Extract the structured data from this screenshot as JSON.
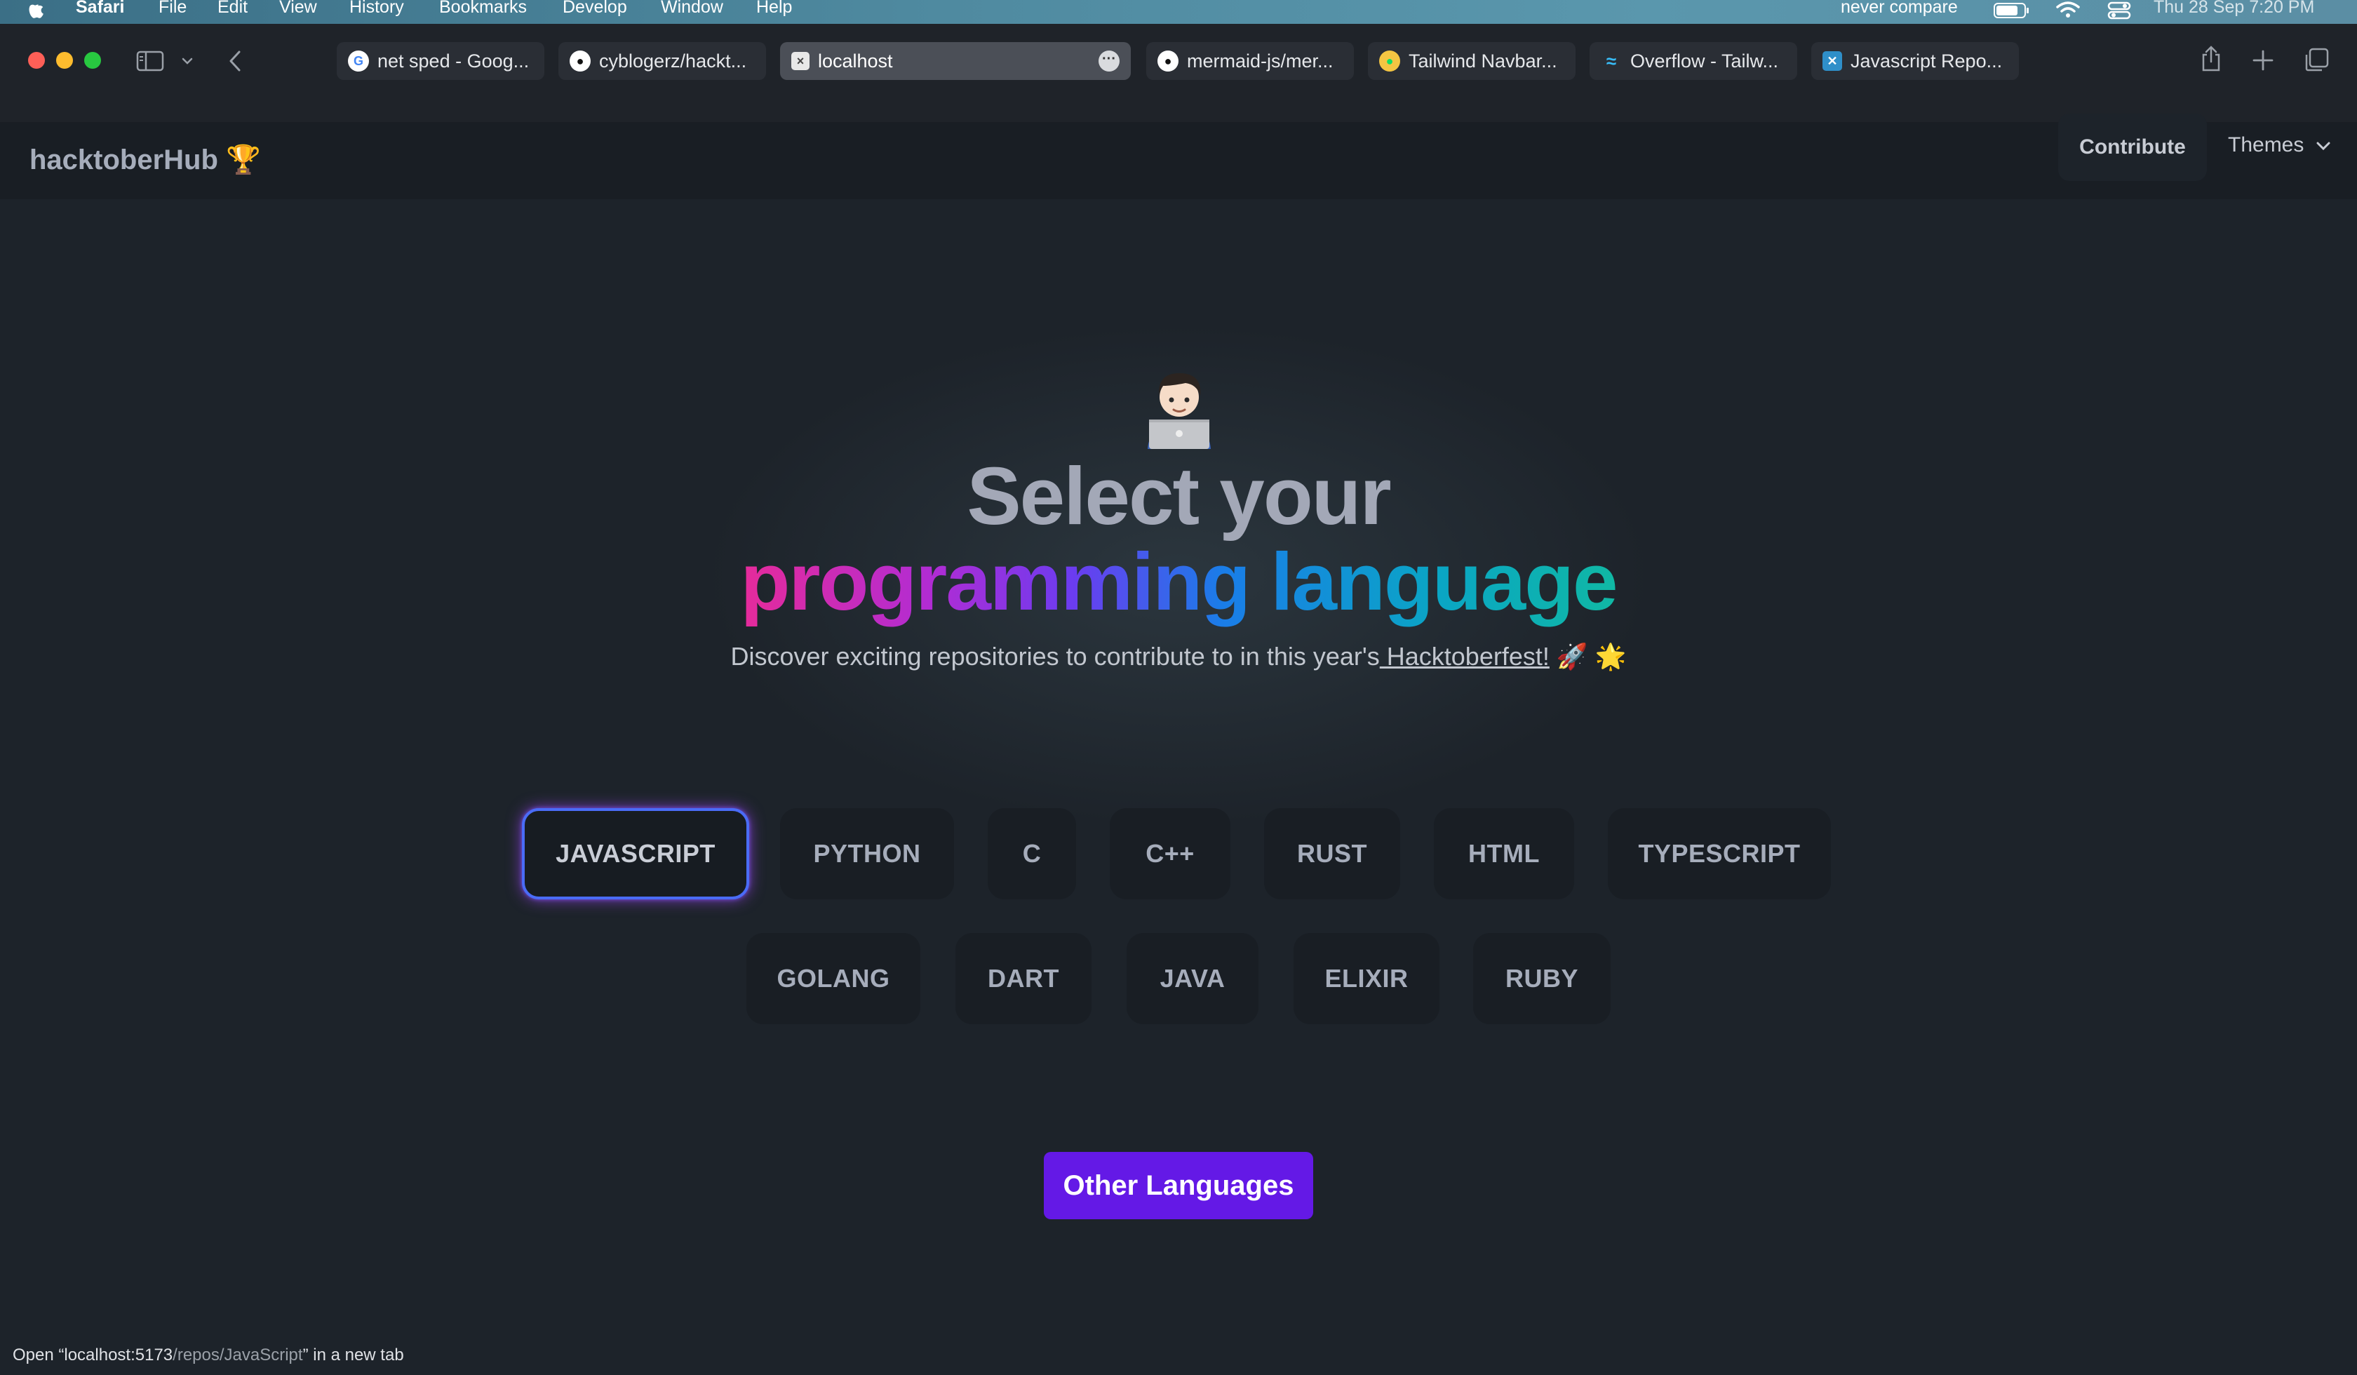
{
  "menubar": {
    "app": "Safari",
    "items": [
      "File",
      "Edit",
      "View",
      "History",
      "Bookmarks",
      "Develop",
      "Window",
      "Help"
    ],
    "right_text": "never compare",
    "datetime": "Thu 28 Sep  7:20 PM"
  },
  "tabs": [
    {
      "label": "net sped - Goog...",
      "icon": "google-icon"
    },
    {
      "label": "cyblogerz/hackt...",
      "icon": "github-icon"
    },
    {
      "label": "localhost",
      "icon": "localhost-icon",
      "active": true
    },
    {
      "label": "mermaid-js/mer...",
      "icon": "github-icon"
    },
    {
      "label": "Tailwind Navbar...",
      "icon": "tailwind-navbar-icon"
    },
    {
      "label": "Overflow - Tailw...",
      "icon": "tailwind-icon"
    },
    {
      "label": "Javascript Repo...",
      "icon": "repo-icon"
    }
  ],
  "navbar": {
    "brand": "hacktoberHub 🏆",
    "contribute": "Contribute",
    "themes": "Themes"
  },
  "hero": {
    "emoji": "🧑🏻‍💻",
    "title_line1": "Select your",
    "title_word1": "programming",
    "title_word2": "language",
    "subtitle_prefix": "Discover exciting repositories to contribute to in this year's",
    "subtitle_link": " Hacktoberfest!",
    "subtitle_suffix": " 🚀 🌟"
  },
  "languages": [
    "JAVASCRIPT",
    "PYTHON",
    "C",
    "C++",
    "RUST",
    "HTML",
    "TYPESCRIPT",
    "GOLANG",
    "DART",
    "JAVA",
    "ELIXIR",
    "RUBY"
  ],
  "selected_language": "JAVASCRIPT",
  "other_button": "Other Languages",
  "status": {
    "prefix": "Open “localhost:5173",
    "path": "/repos/JavaScript",
    "suffix": "” in a new tab"
  },
  "colors": {
    "background": "#1d232a",
    "accent": "#6419e6",
    "selected_border": "#4a6cf7"
  }
}
